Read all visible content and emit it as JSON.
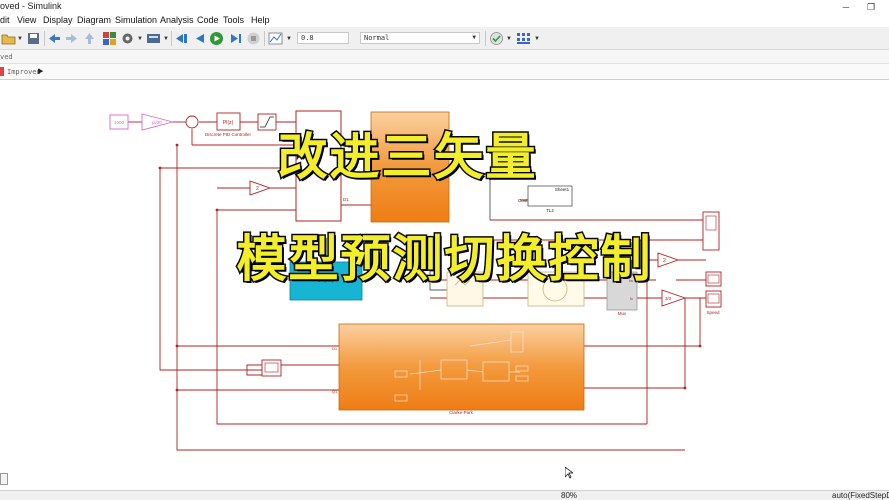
{
  "window": {
    "title": "oved - Simulink"
  },
  "menu": [
    "dit",
    "View",
    "Display",
    "Diagram",
    "Simulation",
    "Analysis",
    "Code",
    "Tools",
    "Help"
  ],
  "toolbar": {
    "stop_time": "0.8",
    "sim_mode": "Normal"
  },
  "tab_fragment": "ved",
  "breadcrumb": {
    "model": "Improved"
  },
  "blocks": {
    "speed_ref": "1000",
    "gain_const": "pi/30",
    "discrete_pid": "Discrete PID Controller",
    "pid_label": "PI(z)",
    "gain2": "2",
    "gain_far": "2",
    "gain_sqrt3": "3/2",
    "scope_label": "Speed",
    "mux_label": "Mux",
    "clarke_park": "Clarke-Park",
    "display_label": "Display",
    "sheet1": "Sheet1",
    "tl2": "TL2",
    "cont": "Cont",
    "port_d1": "D1",
    "port_q1": "Q1",
    "port_iw": "Iw",
    "port_iv": "Iv"
  },
  "caption": {
    "line1": "改进三矢量",
    "line2": "模型预测切换控制"
  },
  "status": {
    "zoom": "80%",
    "solver": "auto(FixedStepD"
  },
  "colors": {
    "orange_block": "#f08a24",
    "cyan_block": "#17b5d4",
    "signal_line": "#b22222",
    "magenta_block": "#d06ad4",
    "caption_fill": "#f3ee2c"
  }
}
